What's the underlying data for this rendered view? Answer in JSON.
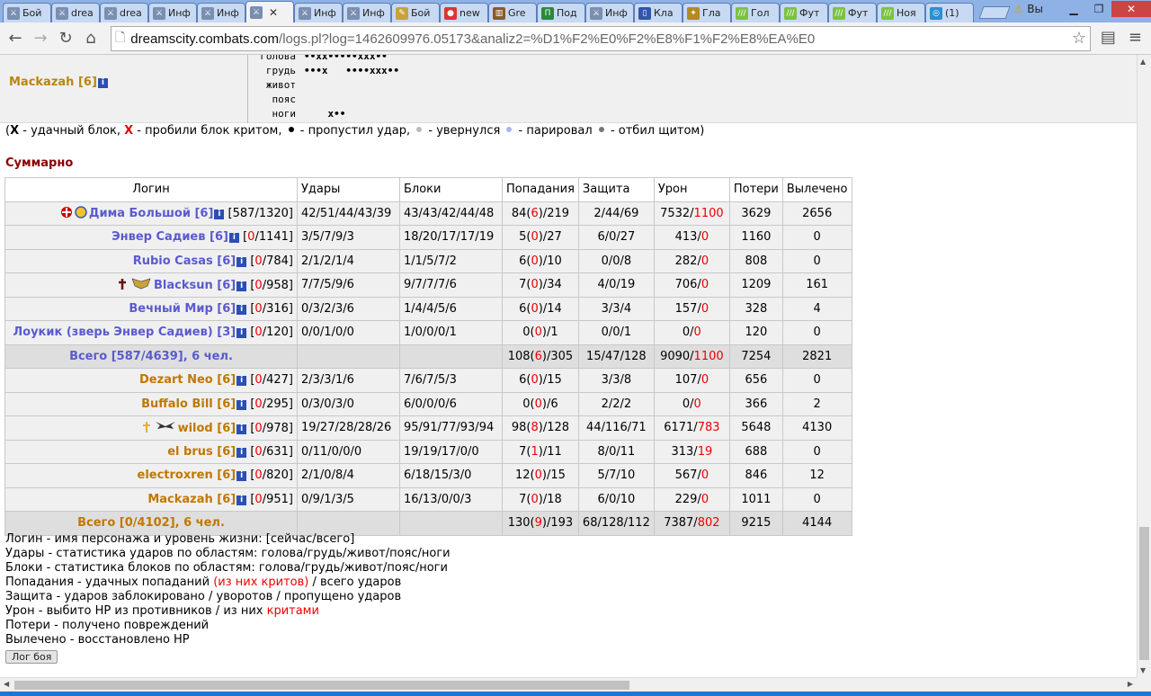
{
  "tabs": [
    {
      "label": "Бой",
      "icon": "swords-icon"
    },
    {
      "label": "drea",
      "icon": "swords-icon"
    },
    {
      "label": "drea",
      "icon": "swords-icon"
    },
    {
      "label": "Инф",
      "icon": "swords-icon"
    },
    {
      "label": "Инф",
      "icon": "swords-icon"
    },
    {
      "label": "",
      "icon": "swords-icon",
      "active": true
    },
    {
      "label": "Инф",
      "icon": "swords-icon"
    },
    {
      "label": "Инф",
      "icon": "swords-icon"
    },
    {
      "label": "Бой",
      "icon": "scroll-icon"
    },
    {
      "label": "new",
      "icon": "red-circle-icon"
    },
    {
      "label": "Gre",
      "icon": "chart-icon"
    },
    {
      "label": "Под",
      "icon": "green-box-icon"
    },
    {
      "label": "Инф",
      "icon": "swords-icon"
    },
    {
      "label": "Кла",
      "icon": "document-icon"
    },
    {
      "label": "Гла",
      "icon": "emblem-icon"
    },
    {
      "label": "Гол",
      "icon": "green-stripes-icon"
    },
    {
      "label": "Фут",
      "icon": "green-stripes-icon"
    },
    {
      "label": "Фут",
      "icon": "green-stripes-icon"
    },
    {
      "label": "Ноя",
      "icon": "green-stripes-icon"
    },
    {
      "label": "(1)",
      "icon": "ring-icon"
    }
  ],
  "window": {
    "warning_label": "Вы"
  },
  "address": {
    "domain": "dreamscity.combats.com",
    "path": "/logs.pl?log=1462609976.05173&analiz2=%D1%F2%E0%F2%E8%F1%F2%E8%EA%E0"
  },
  "top": {
    "name": "Mackazah [6]",
    "zones": [
      {
        "label": "голова",
        "value": "••xx•••••xxx••"
      },
      {
        "label": "грудь",
        "value": "•••x   ••••xxx••"
      },
      {
        "label": "живот",
        "value": ""
      },
      {
        "label": "пояс",
        "value": ""
      },
      {
        "label": "ноги",
        "value": "    x••"
      }
    ]
  },
  "legend": {
    "p1": "(",
    "x_bold": "X",
    "p2": " - удачный блок, ",
    "x_red": "X",
    "p3": " - пробили блок критом, ",
    "p4": " - пропустил удар, ",
    "p5": " - увернулся ",
    "p6": " - парировал ",
    "p7": " - отбил щитом)"
  },
  "summary_title": "Суммарно",
  "table": {
    "headers": [
      "Логин",
      "Удары",
      "Блоки",
      "Попадания",
      "Защита",
      "Урон",
      "Потери",
      "Вылечено"
    ],
    "rows": [
      {
        "team": "blue",
        "icons": [
          "clan-cross-icon",
          "circle-emblem-icon"
        ],
        "name": "Дима Большой [6]",
        "hp_cur": "587",
        "hp_max": "1320",
        "hits": "42/51/44/43/39",
        "blocks": "43/43/42/44/48",
        "hit_a": "84",
        "hit_c": "6",
        "hit_t": "219",
        "defense": "2/44/69",
        "dmg": "7532",
        "dmg_c": "1100",
        "loss": "3629",
        "healed": "2656"
      },
      {
        "team": "blue",
        "icons": [],
        "name": "Энвер Садиев [6]",
        "hp_cur": "0",
        "hp_max": "1141",
        "hits": "3/5/7/9/3",
        "blocks": "18/20/17/17/19",
        "hit_a": "5",
        "hit_c": "0",
        "hit_t": "27",
        "defense": "6/0/27",
        "dmg": "413",
        "dmg_c": "0",
        "loss": "1160",
        "healed": "0"
      },
      {
        "team": "blue",
        "icons": [],
        "name": "Rubio Casas [6]",
        "hp_cur": "0",
        "hp_max": "784",
        "hits": "2/1/2/1/4",
        "blocks": "1/1/5/7/2",
        "hit_a": "6",
        "hit_c": "0",
        "hit_t": "10",
        "defense": "0/0/8",
        "dmg": "282",
        "dmg_c": "0",
        "loss": "808",
        "healed": "0"
      },
      {
        "team": "blue",
        "icons": [
          "dark-cross-icon",
          "winged-emblem-icon"
        ],
        "name": "Blacksun [6]",
        "hp_cur": "0",
        "hp_max": "958",
        "hits": "7/7/5/9/6",
        "blocks": "9/7/7/7/6",
        "hit_a": "7",
        "hit_c": "0",
        "hit_t": "34",
        "defense": "4/0/19",
        "dmg": "706",
        "dmg_c": "0",
        "loss": "1209",
        "healed": "161"
      },
      {
        "team": "blue",
        "icons": [],
        "name": "Вечный Мир [6]",
        "hp_cur": "0",
        "hp_max": "316",
        "hits": "0/3/2/3/6",
        "blocks": "1/4/4/5/6",
        "hit_a": "6",
        "hit_c": "0",
        "hit_t": "14",
        "defense": "3/3/4",
        "dmg": "157",
        "dmg_c": "0",
        "loss": "328",
        "healed": "4"
      },
      {
        "team": "blue",
        "icons": [],
        "name": "Лоукик (зверь Энвер Садиев) [3]",
        "hp_cur": "0",
        "hp_max": "120",
        "hits": "0/0/1/0/0",
        "blocks": "1/0/0/0/1",
        "hit_a": "0",
        "hit_c": "0",
        "hit_t": "1",
        "defense": "0/0/1",
        "dmg": "0",
        "dmg_c": "0",
        "loss": "120",
        "healed": "0"
      },
      {
        "total": true,
        "team": "blue",
        "label": "Всего [587/4639], 6 чел.",
        "hit_a": "108",
        "hit_c": "6",
        "hit_t": "305",
        "defense": "15/47/128",
        "dmg": "9090",
        "dmg_c": "1100",
        "loss": "7254",
        "healed": "2821"
      },
      {
        "team": "orange",
        "icons": [],
        "name": "Dezart Neo [6]",
        "hp_cur": "0",
        "hp_max": "427",
        "hits": "2/3/3/1/6",
        "blocks": "7/6/7/5/3",
        "hit_a": "6",
        "hit_c": "0",
        "hit_t": "15",
        "defense": "3/3/8",
        "dmg": "107",
        "dmg_c": "0",
        "loss": "656",
        "healed": "0"
      },
      {
        "team": "orange",
        "icons": [],
        "name": "Buffalo Bill [6]",
        "hp_cur": "0",
        "hp_max": "295",
        "hits": "0/3/0/3/0",
        "blocks": "6/0/0/0/6",
        "hit_a": "0",
        "hit_c": "0",
        "hit_t": "6",
        "defense": "2/2/2",
        "dmg": "0",
        "dmg_c": "0",
        "loss": "366",
        "healed": "2"
      },
      {
        "team": "orange",
        "icons": [
          "gold-cross-icon",
          "bat-wings-icon"
        ],
        "name": "wilod [6]",
        "hp_cur": "0",
        "hp_max": "978",
        "hits": "19/27/28/28/26",
        "blocks": "95/91/77/93/94",
        "hit_a": "98",
        "hit_c": "8",
        "hit_t": "128",
        "defense": "44/116/71",
        "dmg": "6171",
        "dmg_c": "783",
        "loss": "5648",
        "healed": "4130"
      },
      {
        "team": "orange",
        "icons": [],
        "name": "el brus [6]",
        "hp_cur": "0",
        "hp_max": "631",
        "hits": "0/11/0/0/0",
        "blocks": "19/19/17/0/0",
        "hit_a": "7",
        "hit_c": "1",
        "hit_t": "11",
        "defense": "8/0/11",
        "dmg": "313",
        "dmg_c": "19",
        "loss": "688",
        "healed": "0"
      },
      {
        "team": "orange",
        "icons": [],
        "name": "electroxren [6]",
        "hp_cur": "0",
        "hp_max": "820",
        "hits": "2/1/0/8/4",
        "blocks": "6/18/15/3/0",
        "hit_a": "12",
        "hit_c": "0",
        "hit_t": "15",
        "defense": "5/7/10",
        "dmg": "567",
        "dmg_c": "0",
        "loss": "846",
        "healed": "12"
      },
      {
        "team": "orange",
        "icons": [],
        "name": "Mackazah [6]",
        "hp_cur": "0",
        "hp_max": "951",
        "hits": "0/9/1/3/5",
        "blocks": "16/13/0/0/3",
        "hit_a": "7",
        "hit_c": "0",
        "hit_t": "18",
        "defense": "6/0/10",
        "dmg": "229",
        "dmg_c": "0",
        "loss": "1011",
        "healed": "0"
      },
      {
        "total": true,
        "team": "orange",
        "label": "Всего [0/4102], 6 чел.",
        "hit_a": "130",
        "hit_c": "9",
        "hit_t": "193",
        "defense": "68/128/112",
        "dmg": "7387",
        "dmg_c": "802",
        "loss": "9215",
        "healed": "4144"
      }
    ]
  },
  "notes": {
    "n1": "Логин - имя персонажа и уровень жизни: [сейчас/всего]",
    "n2": "Удары - статистика ударов по областям: голова/грудь/живот/пояс/ноги",
    "n3": "Блоки - статистика блоков по областям: голова/грудь/живот/пояс/ноги",
    "n4a": "Попадания - удачных попаданий ",
    "n4b": "(из них критов)",
    "n4c": " / всего ударов",
    "n5": "Защита - ударов заблокировано / уворотов / пропущено ударов",
    "n6a": "Урон - выбито HP из противников / из них ",
    "n6b": "критами",
    "n7": "Потери - получено повреждений",
    "n8": "Вылечено - восстановлено HP"
  },
  "log_button": "Лог боя",
  "colors": {
    "team_blue": "#5a5acf",
    "team_orange": "#c07800",
    "crit_red": "#e00000",
    "title_red": "#8b0000"
  }
}
